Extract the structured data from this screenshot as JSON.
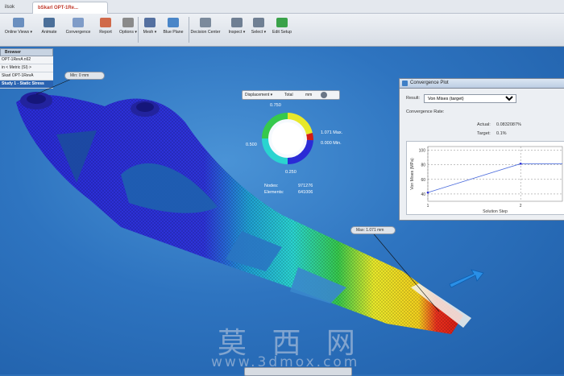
{
  "tabs": {
    "t0": "ilsok",
    "active": "bSkarl OPT-1Re...",
    "t2": "",
    "t3": ""
  },
  "ribbon": {
    "buttons": [
      {
        "label": "Online Views ▾",
        "color": "#6a8fbf"
      },
      {
        "label": "Animate",
        "color": "#4b6f99"
      },
      {
        "label": "Convergence",
        "color": "#7f9cc8"
      },
      {
        "label": "Report",
        "color": "#d06a4a"
      },
      {
        "label": "Options ▾",
        "color": "#8a8a8a"
      },
      {
        "label": "Mesh ▾",
        "color": "#5470a0"
      },
      {
        "label": "Blue Plane",
        "color": "#4a86c8"
      },
      {
        "label": "Decision Center",
        "color": "#7b8a9c"
      },
      {
        "label": "Inspect ▾",
        "color": "#6f7f93"
      },
      {
        "label": "Select ▾",
        "color": "#6f7f93"
      },
      {
        "label": "Edit Setup",
        "color": "#3aa24a"
      }
    ]
  },
  "browser": {
    "header": "Browser",
    "rows": [
      "OPT-1RevA n62",
      "in < Metric (SI) >",
      "Skarl OPT-1RevA",
      "Study 1 - Static Stress"
    ]
  },
  "callouts": {
    "min": "Min: 0 mm",
    "max": "Max: 1.071 mm"
  },
  "result_toolbar": {
    "result": "Displacement ▾",
    "component": "Total",
    "unit": "mm"
  },
  "legend": {
    "top": "0.750",
    "left": "0.500",
    "bottom": "0.250",
    "max": "1.071 Max.",
    "min": "0.000 Min."
  },
  "stats": {
    "nodes_label": "Nodes:",
    "nodes_value": "971276",
    "elements_label": "Elements:",
    "elements_value": "641006"
  },
  "convergence": {
    "title": "Convergence Plot",
    "result_label": "Result:",
    "result_value": "Von Mises (target)",
    "rate_label": "Convergence Rate:",
    "actual_label": "Actual:",
    "actual_value": "0.0832087%",
    "target_label": "Target:",
    "target_value": "0.1%"
  },
  "chart_data": {
    "type": "line",
    "xlabel": "Solution Step",
    "ylabel": "Von Mises (MPa)",
    "x": [
      1,
      2,
      3
    ],
    "y": [
      42,
      81.5,
      81.5
    ],
    "xticks": [
      1,
      2
    ],
    "yticks": [
      40,
      60,
      80,
      100
    ],
    "ylim": [
      30,
      105
    ],
    "xlim": [
      1,
      2.45
    ],
    "grid": true,
    "series_color": "#4a6bdc"
  },
  "watermark": {
    "cn": "莫 西 网",
    "url": "www.3dmox.com"
  }
}
